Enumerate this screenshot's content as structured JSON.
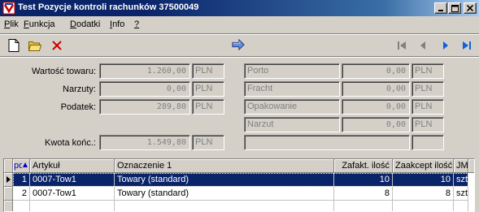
{
  "window": {
    "title": "Test Pozycje kontroli rachunków 37500049"
  },
  "menu": {
    "items": [
      {
        "label": "Plik"
      },
      {
        "label": "Funkcja"
      },
      {
        "label": "Dodatki"
      },
      {
        "label": "Info"
      },
      {
        "label": "?"
      }
    ]
  },
  "toolbar": {
    "icons": [
      "new-document-icon",
      "open-folder-icon",
      "delete-icon",
      "execute-icon",
      "first-icon",
      "previous-icon",
      "next-icon",
      "last-icon"
    ]
  },
  "form": {
    "left": [
      {
        "label": "Wartość towaru:",
        "value": "1.260,00",
        "currency": "PLN"
      },
      {
        "label": "Narzuty:",
        "value": "0,00",
        "currency": "PLN"
      },
      {
        "label": "Podatek:",
        "value": "289,80",
        "currency": "PLN"
      }
    ],
    "total": {
      "label": "Kwota końc.:",
      "value": "1.549,80",
      "currency": "PLN"
    },
    "right": [
      {
        "name": "Porto",
        "value": "0,00",
        "currency": "PLN"
      },
      {
        "name": "Fracht",
        "value": "0,00",
        "currency": "PLN"
      },
      {
        "name": "Opakowanie",
        "value": "0,00",
        "currency": "PLN"
      },
      {
        "name": "Narzut",
        "value": "0,00",
        "currency": "PLN"
      }
    ]
  },
  "grid": {
    "columns": [
      "poz",
      "Artykuł",
      "Oznaczenie 1",
      "Zafakt. ilość",
      "Zaakcept ilość",
      "JM"
    ],
    "rows": [
      {
        "poz": "1",
        "artykul": "0007-Tow1",
        "oznaczenie": "Towary (standard)",
        "zafakt": "10",
        "zaakcept": "10",
        "jm": "szt",
        "selected": true
      },
      {
        "poz": "2",
        "artykul": "0007-Tow1",
        "oznaczenie": "Towary (standard)",
        "zafakt": "8",
        "zaakcept": "8",
        "jm": "szt",
        "selected": false
      }
    ]
  }
}
